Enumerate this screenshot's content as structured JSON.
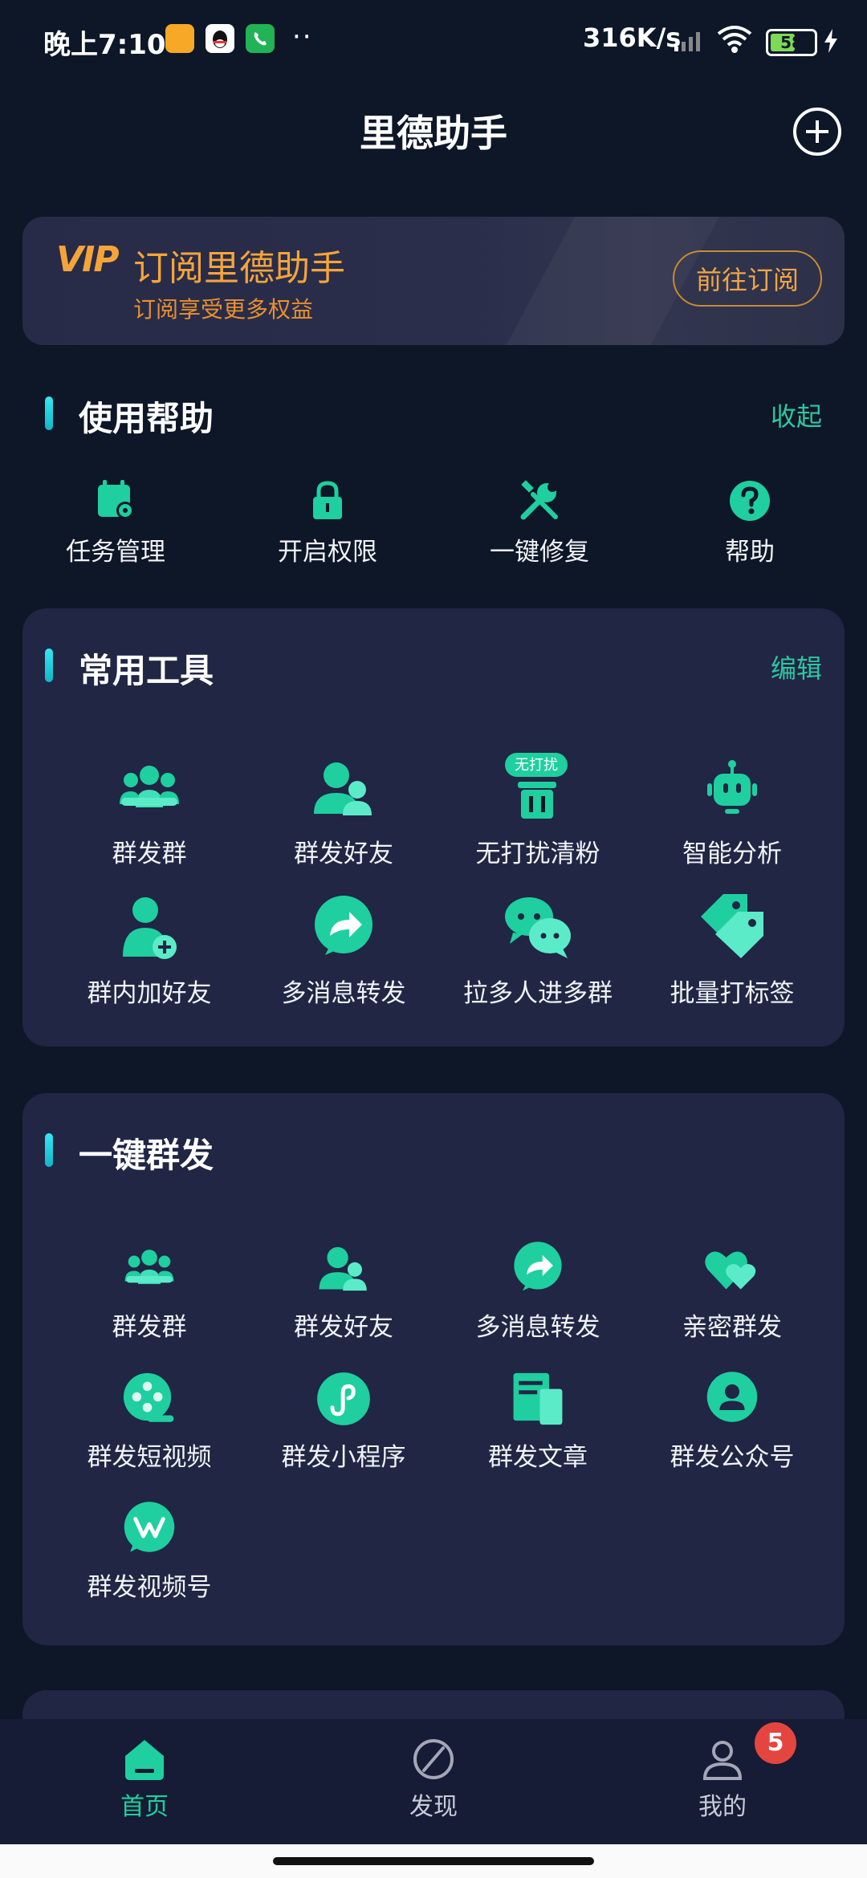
{
  "status_bar": {
    "time": "晚上7:10",
    "dots": "··",
    "speed": "316K/s",
    "battery": "58"
  },
  "header": {
    "title": "里德助手"
  },
  "vip": {
    "logo": "VIP",
    "title": "订阅里德助手",
    "subtitle": "订阅享受更多权益",
    "button": "前往订阅"
  },
  "help": {
    "title": "使用帮助",
    "action": "收起",
    "items": [
      {
        "label": "任务管理",
        "icon": "calendar-gear-icon"
      },
      {
        "label": "开启权限",
        "icon": "lock-icon"
      },
      {
        "label": "一键修复",
        "icon": "wrench-screwdriver-icon"
      },
      {
        "label": "帮助",
        "icon": "question-icon"
      }
    ]
  },
  "tools": {
    "title": "常用工具",
    "action": "编辑",
    "badge": "无打扰",
    "items": [
      {
        "label": "群发群",
        "icon": "group-icon"
      },
      {
        "label": "群发好友",
        "icon": "friends-icon"
      },
      {
        "label": "无打扰清粉",
        "icon": "trash-icon"
      },
      {
        "label": "智能分析",
        "icon": "robot-icon"
      },
      {
        "label": "群内加好友",
        "icon": "add-person-icon"
      },
      {
        "label": "多消息转发",
        "icon": "forward-icon"
      },
      {
        "label": "拉多人进多群",
        "icon": "chat-bubbles-icon"
      },
      {
        "label": "批量打标签",
        "icon": "tags-icon"
      }
    ]
  },
  "broadcast": {
    "title": "一键群发",
    "items": [
      {
        "label": "群发群",
        "icon": "group-icon"
      },
      {
        "label": "群发好友",
        "icon": "friends-icon"
      },
      {
        "label": "多消息转发",
        "icon": "forward-icon"
      },
      {
        "label": "亲密群发",
        "icon": "hearts-icon"
      },
      {
        "label": "群发短视频",
        "icon": "video-reel-icon"
      },
      {
        "label": "群发小程序",
        "icon": "mini-program-icon"
      },
      {
        "label": "群发文章",
        "icon": "article-icon"
      },
      {
        "label": "群发公众号",
        "icon": "official-account-icon"
      },
      {
        "label": "群发视频号",
        "icon": "channels-icon"
      }
    ]
  },
  "nav": {
    "home": "首页",
    "discover": "发现",
    "mine": "我的",
    "badge": "5"
  },
  "colors": {
    "background": "#0d1728",
    "card": "#202644",
    "accent": "#2fc6a1",
    "icon": "#1fcf9f",
    "vip": "#f5a43a",
    "badge": "#e4463f"
  }
}
